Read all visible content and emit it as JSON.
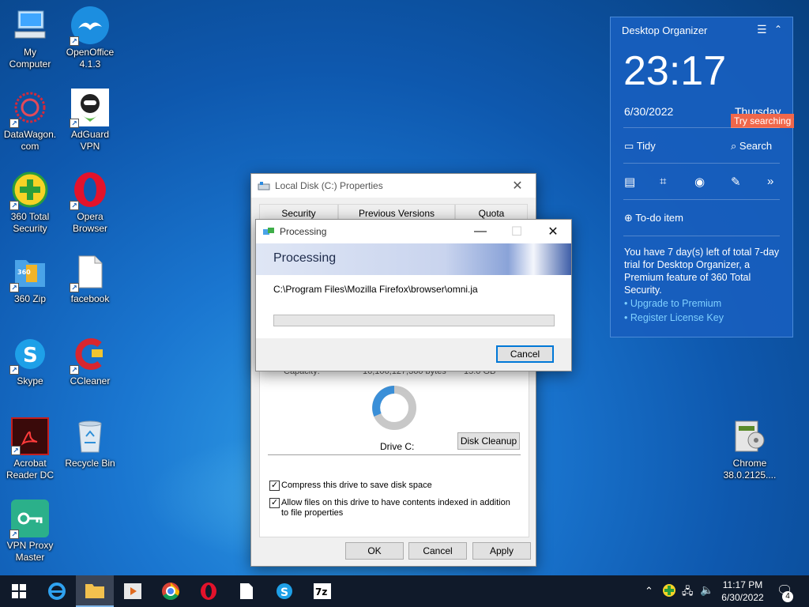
{
  "desktop_icons": [
    {
      "label": "My\nComputer",
      "icon": "computer-icon"
    },
    {
      "label": "OpenOffice\n4.1.3",
      "icon": "openoffice-icon"
    },
    {
      "label": "DataWagon.\ncom",
      "icon": "datawagon-icon"
    },
    {
      "label": "AdGuard\nVPN",
      "icon": "adguard-icon"
    },
    {
      "label": "360 Total\nSecurity",
      "icon": "360-total-security-icon"
    },
    {
      "label": "Opera\nBrowser",
      "icon": "opera-icon"
    },
    {
      "label": "360 Zip",
      "icon": "360-zip-icon"
    },
    {
      "label": "facebook",
      "icon": "file-icon"
    },
    {
      "label": "Skype",
      "icon": "skype-icon"
    },
    {
      "label": "CCleaner",
      "icon": "ccleaner-icon"
    },
    {
      "label": "Acrobat\nReader DC",
      "icon": "acrobat-icon"
    },
    {
      "label": "Recycle Bin",
      "icon": "recycle-bin-icon"
    },
    {
      "label": "VPN Proxy\nMaster",
      "icon": "vpn-proxy-icon"
    },
    {
      "label": "Chrome\n38.0.2125....",
      "icon": "chrome-installer-icon"
    }
  ],
  "properties": {
    "title": "Local Disk (C:) Properties",
    "tabs": [
      "Security",
      "Previous Versions",
      "Quota"
    ],
    "capacity_label": "Capacity:",
    "capacity_bytes": "16,106,127,360 bytes",
    "capacity_gb": "15.0 GB",
    "drive_label": "Drive C:",
    "disk_cleanup": "Disk Cleanup",
    "compress_label": "Compress this drive to save disk space",
    "index_label": "Allow files on this drive to have contents indexed in addition to file properties",
    "ok": "OK",
    "cancel": "Cancel",
    "apply": "Apply"
  },
  "processing": {
    "title": "Processing",
    "heading": "Processing",
    "path": "C:\\Program Files\\Mozilla Firefox\\browser\\omni.ja",
    "progress": 0,
    "cancel": "Cancel"
  },
  "organizer": {
    "title": "Desktop Organizer",
    "time": "23:17",
    "date": "6/30/2022",
    "weekday": "Thursday",
    "tooltip": "Try searching for",
    "tidy": "Tidy",
    "search": "Search",
    "todo": "To-do item",
    "trial_text": "You have 7 day(s) left of total 7-day trial for Desktop Organizer, a Premium feature of 360 Total Security.",
    "upgrade": "• Upgrade to Premium",
    "register": "• Register License Key"
  },
  "taskbar": {
    "time": "11:17 PM",
    "date": "6/30/2022",
    "notifications": "4"
  },
  "colors": {
    "desktop": "#1a76d0",
    "panel": "#185ebe",
    "accent_link": "#7fd0ff",
    "tooltip": "#f0674a"
  }
}
